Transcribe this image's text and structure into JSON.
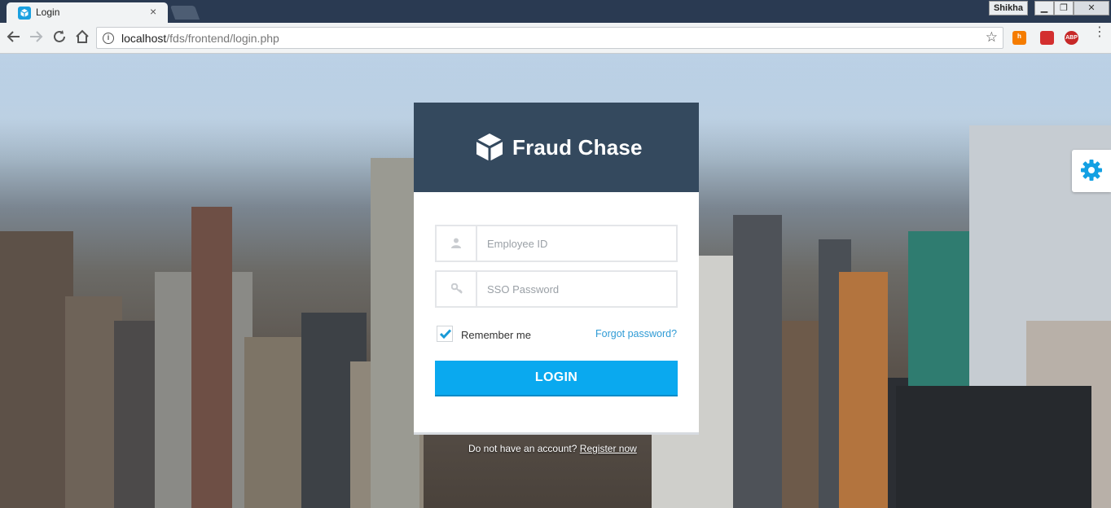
{
  "browser": {
    "tab_title": "Login",
    "tab_close": "×",
    "user_name": "Shikha",
    "url_host": "localhost",
    "url_path": "/fds/frontend/login.php",
    "ext_abp": "ABP"
  },
  "login": {
    "brand": "Fraud Chase",
    "employee_placeholder": "Employee ID",
    "password_placeholder": "SSO Password",
    "remember_label": "Remember me",
    "remember_checked": true,
    "forgot_label": "Forgot password?",
    "login_label": "LOGIN",
    "register_prompt": "Do not have an account?",
    "register_link": "Register now"
  },
  "colors": {
    "header_bg": "#34495e",
    "button_bg": "#0aa9ef",
    "link": "#2f9bd5",
    "accent": "#1aa0e0"
  },
  "icons": {
    "brand": "cube-icon",
    "employee": "user-icon",
    "password": "key-icon",
    "settings": "gear-icon"
  }
}
